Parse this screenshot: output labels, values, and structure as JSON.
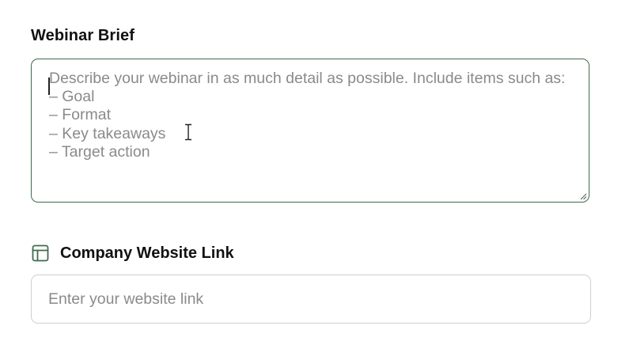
{
  "brief": {
    "label": "Webinar Brief",
    "placeholder": "Describe your webinar in as much detail as possible. Include items such as:\n– Goal\n– Format\n– Key takeaways\n– Target action",
    "value": ""
  },
  "website": {
    "label": "Company Website Link",
    "icon": "layout-icon",
    "placeholder": "Enter your website link",
    "value": ""
  },
  "colors": {
    "focus_border": "#3f6b4e",
    "icon": "#3f6b4e",
    "input_border": "#cfcfcf",
    "placeholder_text": "#8a8a8a",
    "label_text": "#111111"
  }
}
